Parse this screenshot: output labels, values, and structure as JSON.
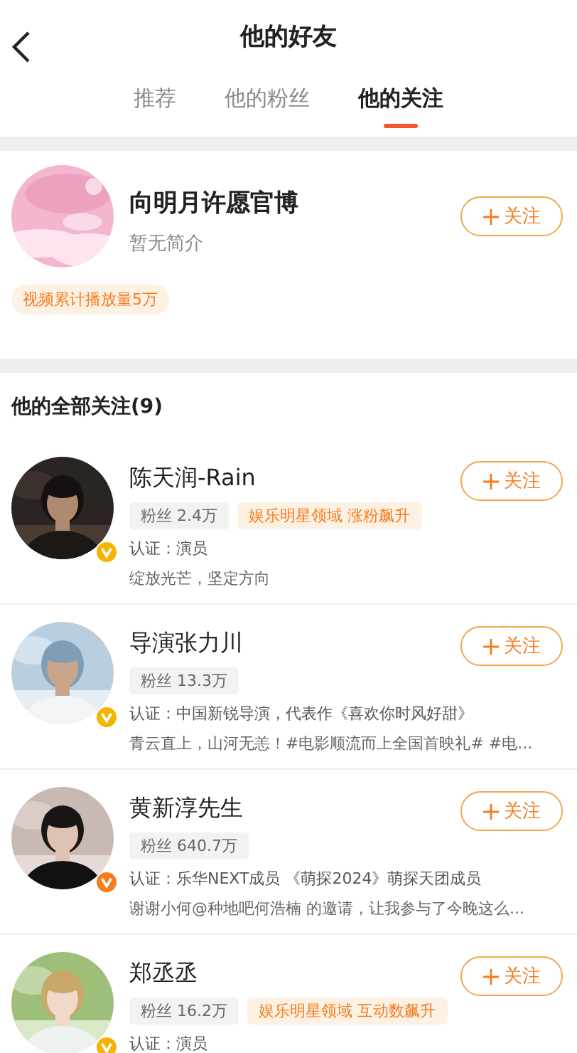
{
  "header": {
    "title": "他的好友"
  },
  "tabs": [
    {
      "label": "推荐",
      "selected": false
    },
    {
      "label": "他的粉丝",
      "selected": false
    },
    {
      "label": "他的关注",
      "selected": true
    }
  ],
  "featured": {
    "name": "向明月许愿官博",
    "intro": "暂无简介",
    "follow_label": "关注",
    "stat_tag": "视频累计播放量5万"
  },
  "section_title": "他的全部关注(9)",
  "follows": [
    {
      "name": "陈天润-Rain",
      "color": "#f5b400",
      "fans": "粉丝 2.4万",
      "trend": "娱乐明星领域 涨粉飙升",
      "verified": "认证：演员",
      "bio": "绽放光芒，坚定方向",
      "follow_label": "关注"
    },
    {
      "name": "导演张力川",
      "color": "#f5b400",
      "fans": "粉丝 13.3万",
      "verified": "认证：中国新锐导演，代表作《喜欢你时风好甜》",
      "bio": "青云直上，山河无恙！#电影顺流而上全国首映礼# #电...",
      "follow_label": "关注"
    },
    {
      "name": "黄新淳先生",
      "color": "#f57c1f",
      "fans": "粉丝 640.7万",
      "verified": "认证：乐华NEXT成员 《萌探2024》萌探天团成员",
      "bio": "谢谢小何@种地吧何浩楠 的邀请，让我参与了今晚这么...",
      "follow_label": "关注"
    },
    {
      "name": "郑丞丞",
      "color": "#f5b400",
      "fans": "粉丝 16.2万",
      "trend": "娱乐明星领域 互动数飙升",
      "verified": "认证：演员",
      "follow_label": "关注"
    }
  ]
}
